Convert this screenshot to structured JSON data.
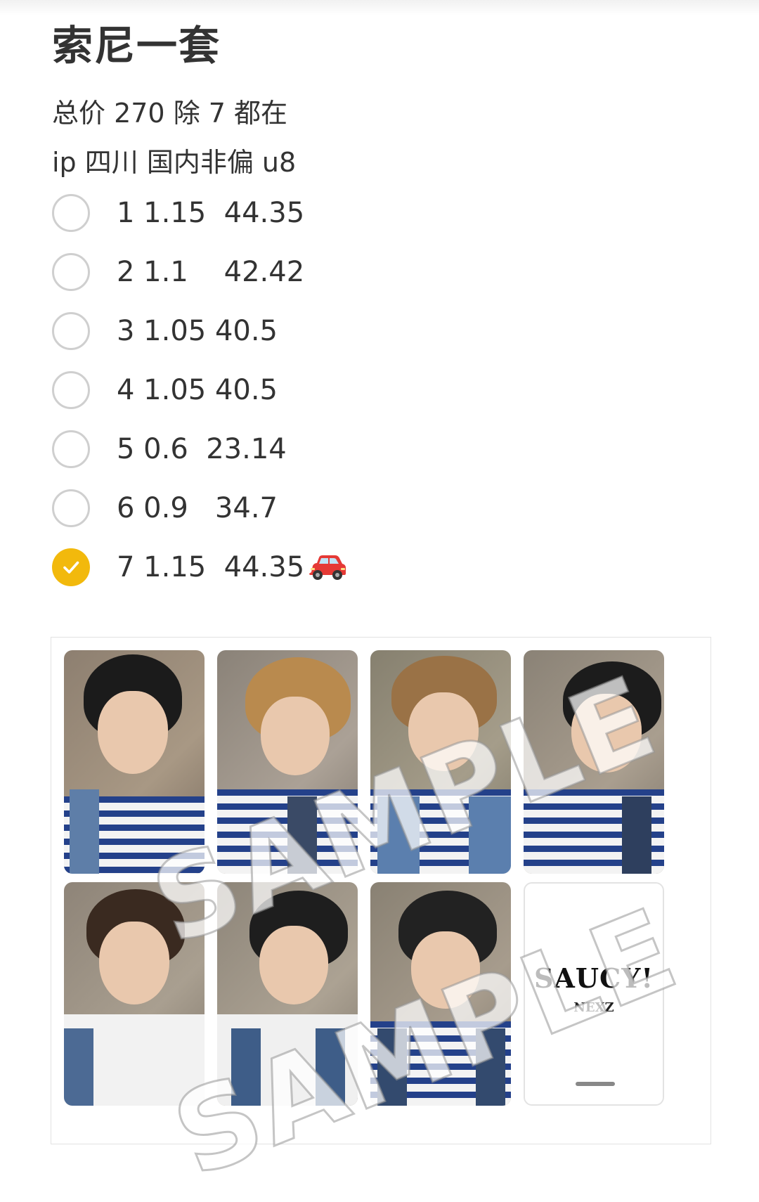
{
  "note": {
    "title": "索尼一套",
    "lines": [
      "总价 270 除 7 都在",
      "ip 四川  国内非偏 u8"
    ],
    "checklist": [
      {
        "text": "1 1.15  44.35",
        "checked": false
      },
      {
        "text": "2 1.1    42.42",
        "checked": false
      },
      {
        "text": "3 1.05 40.5",
        "checked": false
      },
      {
        "text": "4 1.05 40.5",
        "checked": false
      },
      {
        "text": "5 0.6  23.14",
        "checked": false
      },
      {
        "text": "6 0.9   34.7",
        "checked": false
      },
      {
        "text": "7 1.15  44.35",
        "checked": true,
        "emoji": "car-icon"
      }
    ]
  },
  "image": {
    "watermark": "SAMPLE",
    "logo_text": "SAUCY!",
    "logo_sub": "NEXZ"
  },
  "colors": {
    "check": "#f2b90c",
    "circle_border": "#cfcfcf",
    "text": "#333333"
  }
}
